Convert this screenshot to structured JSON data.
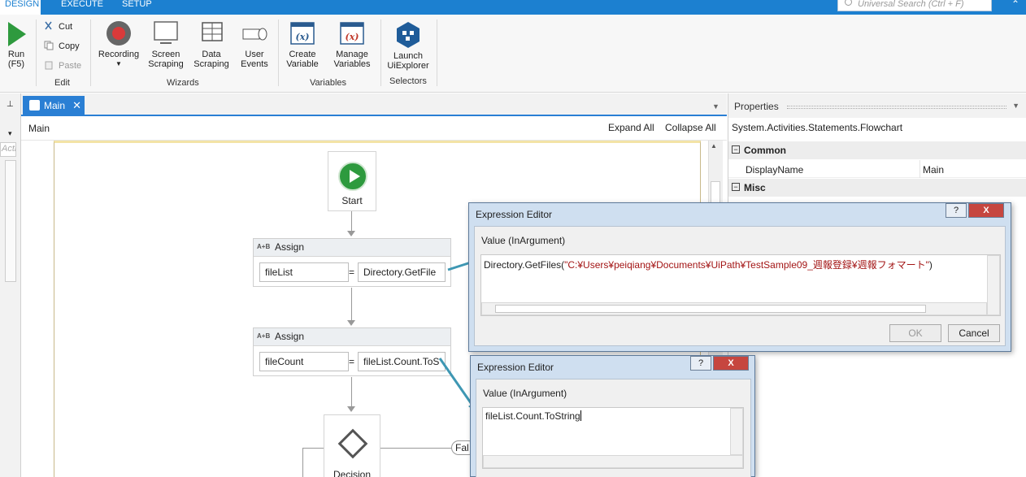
{
  "tabs": [
    "DESIGN",
    "EXECUTE",
    "SETUP"
  ],
  "search": {
    "placeholder": "Universal Search (Ctrl + F)"
  },
  "ribbon": {
    "run": {
      "label": "Run",
      "shortcut": "(F5)"
    },
    "edit": {
      "cut": "Cut",
      "copy": "Copy",
      "paste": "Paste",
      "group": "Edit"
    },
    "wizards": {
      "recording": "Recording",
      "screen_scraping": [
        "Screen",
        "Scraping"
      ],
      "data_scraping": [
        "Data",
        "Scraping"
      ],
      "user_events": [
        "User",
        "Events"
      ],
      "group": "Wizards"
    },
    "variables": {
      "create": [
        "Create",
        "Variable"
      ],
      "manage": [
        "Manage",
        "Variables"
      ],
      "group": "Variables"
    },
    "selectors": {
      "launch": [
        "Launch",
        "UiExplorer"
      ],
      "group": "Selectors"
    }
  },
  "left_panel": {
    "search_stub": "Acti"
  },
  "doc_tab": {
    "title": "Main"
  },
  "designer": {
    "breadcrumb": "Main",
    "expand_all": "Expand All",
    "collapse_all": "Collapse All"
  },
  "flow": {
    "start_label": "Start",
    "assign1": {
      "title": "Assign",
      "to": "fileList",
      "value": "Directory.GetFile"
    },
    "assign2": {
      "title": "Assign",
      "to": "fileCount",
      "value": "fileList.Count.ToS"
    },
    "decision_label": "Decision",
    "false_label": "Fal"
  },
  "properties": {
    "title": "Properties",
    "type": "System.Activities.Statements.Flowchart",
    "common": "Common",
    "display_name_label": "DisplayName",
    "display_name_value": "Main",
    "misc": "Misc"
  },
  "dialog1": {
    "title": "Expression Editor",
    "label": "Value (InArgument)",
    "expr_prefix": "Directory.GetFiles(",
    "expr_string": "\"C:¥Users¥peiqiang¥Documents¥UiPath¥TestSample09_週報登録¥週報フォマート\"",
    "expr_suffix": ")",
    "ok": "OK",
    "cancel": "Cancel",
    "help": "?",
    "close": "X"
  },
  "dialog2": {
    "title": "Expression Editor",
    "label": "Value (InArgument)",
    "expr": "fileList.Count.ToString",
    "help": "?",
    "close": "X"
  },
  "colors": {
    "accent": "#1c80d0",
    "start_green": "#2e9a3e",
    "arrow_teal": "#3e97b3",
    "string_red": "#a31515"
  }
}
